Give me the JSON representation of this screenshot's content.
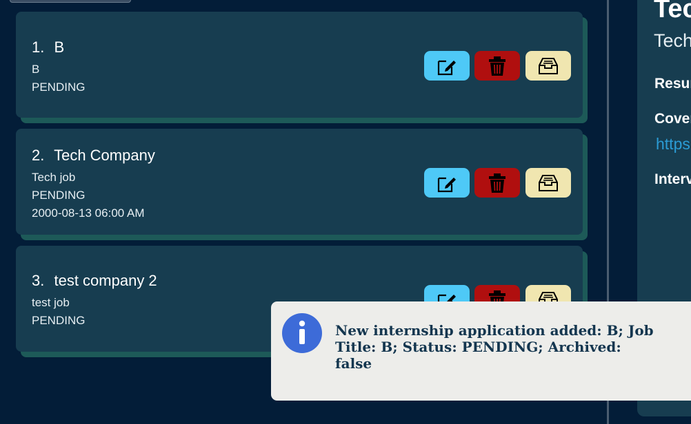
{
  "applications": [
    {
      "index": "1.",
      "company": "B",
      "job_title": "B",
      "status": "PENDING",
      "interview": ""
    },
    {
      "index": "2.",
      "company": "Tech Company",
      "job_title": "Tech job",
      "status": "PENDING",
      "interview": "2000-08-13 06:00 AM"
    },
    {
      "index": "3.",
      "company": "test company 2",
      "job_title": "test job",
      "status": "PENDING",
      "interview": ""
    }
  ],
  "actions": {
    "edit_icon": "edit-icon",
    "delete_icon": "trash-icon",
    "archive_icon": "archive-icon",
    "colors": {
      "edit": "#4ec9f7",
      "delete": "#b00f0f",
      "archive": "#f0e6b0"
    }
  },
  "detail": {
    "title": "Tec",
    "subtitle": "Tech",
    "resume_label": "Resur",
    "cover_label": "Cover",
    "cover_link": "https",
    "interview_label": "Interv"
  },
  "toast": {
    "message": "New internship application added: B; Job Title: B; Status: PENDING; Archived: false",
    "icon": "info-icon"
  },
  "colors": {
    "background": "#031d38",
    "card": "#173d50",
    "card_shadow": "#1d5a58",
    "link": "#2b9bd4"
  }
}
